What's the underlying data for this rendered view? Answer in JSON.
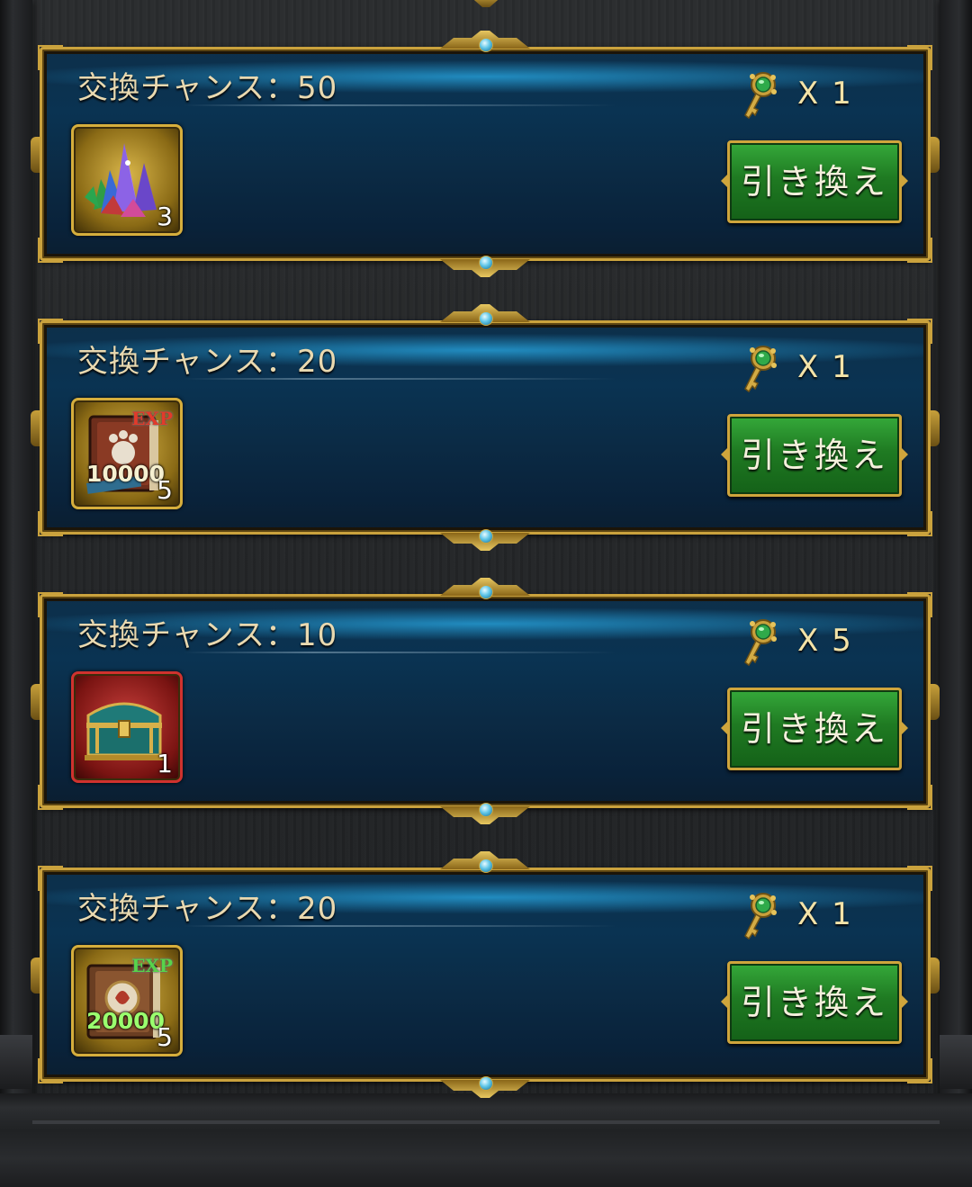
{
  "colors": {
    "panel_blue": "#0a3352",
    "gold_frame": "#caa23d",
    "button_green": "#1f7a22",
    "label_text": "#e9d9b0"
  },
  "cards": [
    {
      "chance_text": "交換チャンス：50",
      "cost_icon": "gold-key-icon",
      "cost_text": "X 1",
      "item": {
        "icon": "purple-crystal-cluster-icon",
        "count": "3",
        "qty_label": "",
        "tag": ""
      },
      "button_label": "引き換え"
    },
    {
      "chance_text": "交換チャンス：20",
      "cost_icon": "gold-key-icon",
      "cost_text": "X 1",
      "item": {
        "icon": "exp-book-icon",
        "count": "5",
        "qty_label": "10000",
        "tag": "EXP"
      },
      "button_label": "引き換え"
    },
    {
      "chance_text": "交換チャンス：10",
      "cost_icon": "gold-key-icon",
      "cost_text": "X 5",
      "item": {
        "icon": "treasure-chest-icon",
        "count": "1",
        "qty_label": "",
        "tag": ""
      },
      "button_label": "引き換え"
    },
    {
      "chance_text": "交換チャンス：20",
      "cost_icon": "gold-key-icon",
      "cost_text": "X 1",
      "item": {
        "icon": "exp-book-icon",
        "count": "5",
        "qty_label": "20000",
        "tag": "EXP"
      },
      "button_label": "引き換え"
    }
  ]
}
